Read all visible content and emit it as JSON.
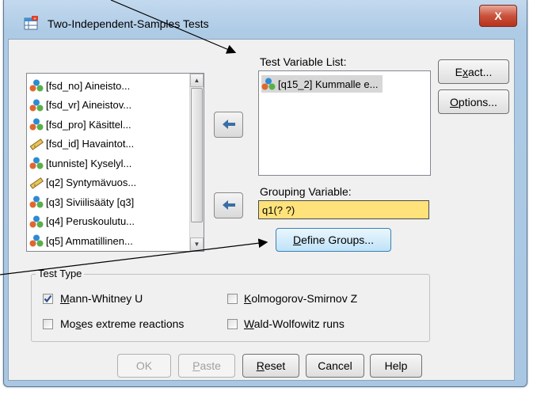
{
  "window": {
    "title": "Two-Independent-Samples Tests",
    "close_label": "X"
  },
  "variables_list": {
    "items": [
      {
        "label": "[fsd_no] Aineisto...",
        "icon": "nominal-variable-icon"
      },
      {
        "label": "[fsd_vr] Aineistov...",
        "icon": "nominal-variable-icon"
      },
      {
        "label": "[fsd_pro] Käsittel...",
        "icon": "nominal-variable-icon"
      },
      {
        "label": "[fsd_id] Havaintot...",
        "icon": "scale-variable-icon"
      },
      {
        "label": "[tunniste] Kyselyl...",
        "icon": "nominal-variable-icon"
      },
      {
        "label": "[q2] Syntymävuos...",
        "icon": "scale-variable-icon"
      },
      {
        "label": "[q3] Siviilisääty [q3]",
        "icon": "nominal-variable-icon"
      },
      {
        "label": "[q4] Peruskoulutu...",
        "icon": "nominal-variable-icon"
      },
      {
        "label": "[q5] Ammatillinen...",
        "icon": "nominal-variable-icon"
      }
    ]
  },
  "test_variable": {
    "label": "Test Variable List:",
    "items": [
      {
        "label": "[q15_2] Kummalle e...",
        "icon": "nominal-variable-icon"
      }
    ]
  },
  "grouping": {
    "label": "Grouping Variable:",
    "value": "q1(? ?)",
    "define_groups": "Define Groups..."
  },
  "side_buttons": {
    "exact": "Exact...",
    "options": "Options..."
  },
  "test_type": {
    "title": "Test Type",
    "options": [
      {
        "label": "Mann-Whitney U",
        "checked": true
      },
      {
        "label": "Kolmogorov-Smirnov Z",
        "checked": false
      },
      {
        "label": "Moses extreme reactions",
        "checked": false
      },
      {
        "label": "Wald-Wolfowitz runs",
        "checked": false
      }
    ]
  },
  "footer": {
    "ok": "OK",
    "paste": "Paste",
    "reset": "Reset",
    "cancel": "Cancel",
    "help": "Help"
  }
}
